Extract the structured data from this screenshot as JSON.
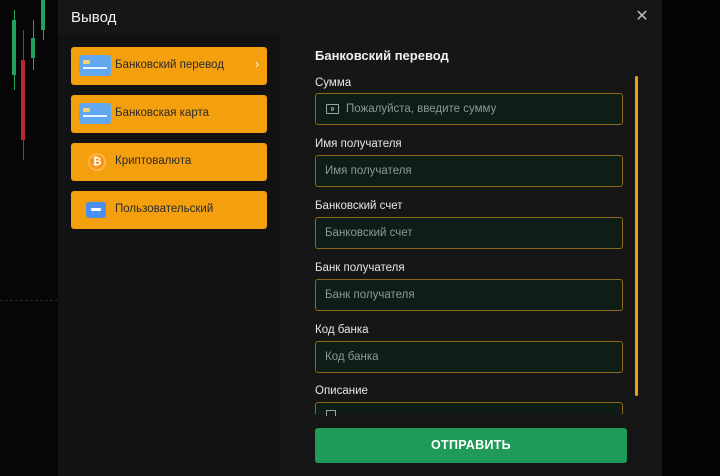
{
  "dialog": {
    "title": "Вывод",
    "close_symbol": "✕"
  },
  "methods": [
    {
      "label": "Банковский перевод",
      "icon": "bank-card-icon",
      "active": true,
      "arrow": "›"
    },
    {
      "label": "Банковская карта",
      "icon": "bank-card-icon"
    },
    {
      "label": "Криптовалюта",
      "icon": "bitcoin-icon",
      "icon_glyph": "₿"
    },
    {
      "label": "Пользовательский",
      "icon": "custom-card-icon"
    }
  ],
  "form": {
    "title": "Банковский перевод",
    "fields": [
      {
        "label": "Сумма",
        "placeholder": "Пожалуйста, введите сумму",
        "value": ""
      },
      {
        "label": "Имя получателя",
        "placeholder": "Имя получателя",
        "value": ""
      },
      {
        "label": "Банковский счет",
        "placeholder": "Банковский счет",
        "value": ""
      },
      {
        "label": "Банк получателя",
        "placeholder": "Банк получателя",
        "value": ""
      },
      {
        "label": "Код банка",
        "placeholder": "Код банка",
        "value": ""
      },
      {
        "label": "Описание"
      }
    ],
    "submit_label": "ОТПРАВИТЬ"
  },
  "colors": {
    "accent": "#f4a00e",
    "submit": "#1f9a58",
    "field_bg": "#0e1d16",
    "field_border": "#8a6a18"
  }
}
